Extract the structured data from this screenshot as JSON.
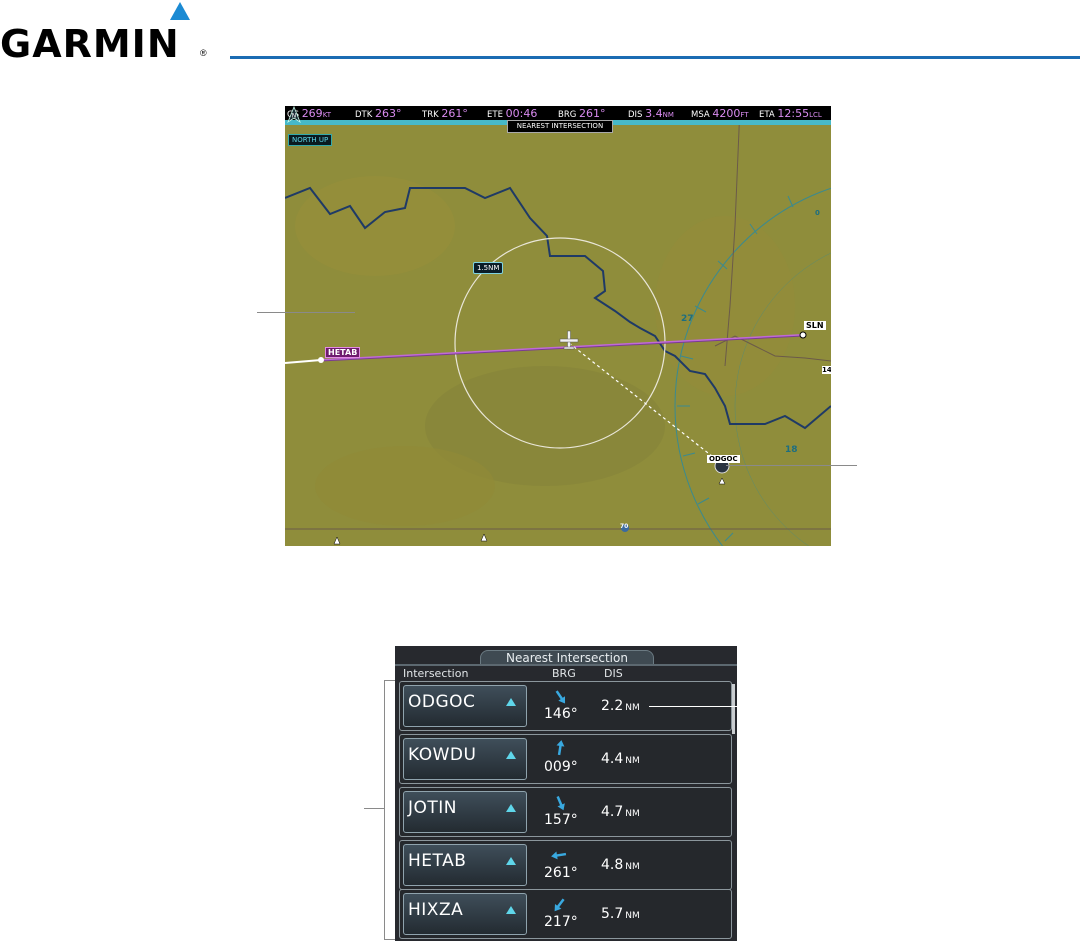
{
  "brand": {
    "name": "GARMIN",
    "reg": "®",
    "accent": "#1b8ad3"
  },
  "map": {
    "databar": {
      "gs": {
        "label": "GS",
        "value": "269",
        "unit": "KT"
      },
      "dtk": {
        "label": "DTK",
        "value": "263°"
      },
      "trk": {
        "label": "TRK",
        "value": "261°"
      },
      "ete": {
        "label": "ETE",
        "value": "00:46"
      },
      "brg": {
        "label": "BRG",
        "value": "261°"
      },
      "dis": {
        "label": "DIS",
        "value": "3.4",
        "unit": "NM"
      },
      "msa": {
        "label": "MSA",
        "value": "4200",
        "unit": "FT"
      },
      "eta": {
        "label": "ETA",
        "value": "12:55",
        "unit": "LCL"
      }
    },
    "title": "NEAREST INTERSECTION",
    "orientation": "NORTH UP",
    "compass_letter": "N",
    "range_ring": "1.5NM",
    "waypoints": {
      "hetab": "HETAB",
      "sln": "SLN",
      "odgoc": "ODGOC"
    },
    "compass_marks": {
      "n27": "27",
      "n18": "18",
      "n0": "0",
      "n14": "14",
      "n70": "70"
    }
  },
  "panel": {
    "title": "Nearest Intersection",
    "columns": {
      "intersection": "Intersection",
      "brg": "BRG",
      "dis": "DIS"
    },
    "rows": [
      {
        "name": "ODGOC",
        "brg": "146°",
        "dis": "2.2",
        "unit": "NM",
        "arrow_angle": 146
      },
      {
        "name": "KOWDU",
        "brg": "009°",
        "dis": "4.4",
        "unit": "NM",
        "arrow_angle": 9
      },
      {
        "name": "JOTIN",
        "brg": "157°",
        "dis": "4.7",
        "unit": "NM",
        "arrow_angle": 157
      },
      {
        "name": "HETAB",
        "brg": "261°",
        "dis": "4.8",
        "unit": "NM",
        "arrow_angle": 261
      },
      {
        "name": "HIXZA",
        "brg": "217°",
        "dis": "5.7",
        "unit": "NM",
        "arrow_angle": 217
      }
    ]
  }
}
